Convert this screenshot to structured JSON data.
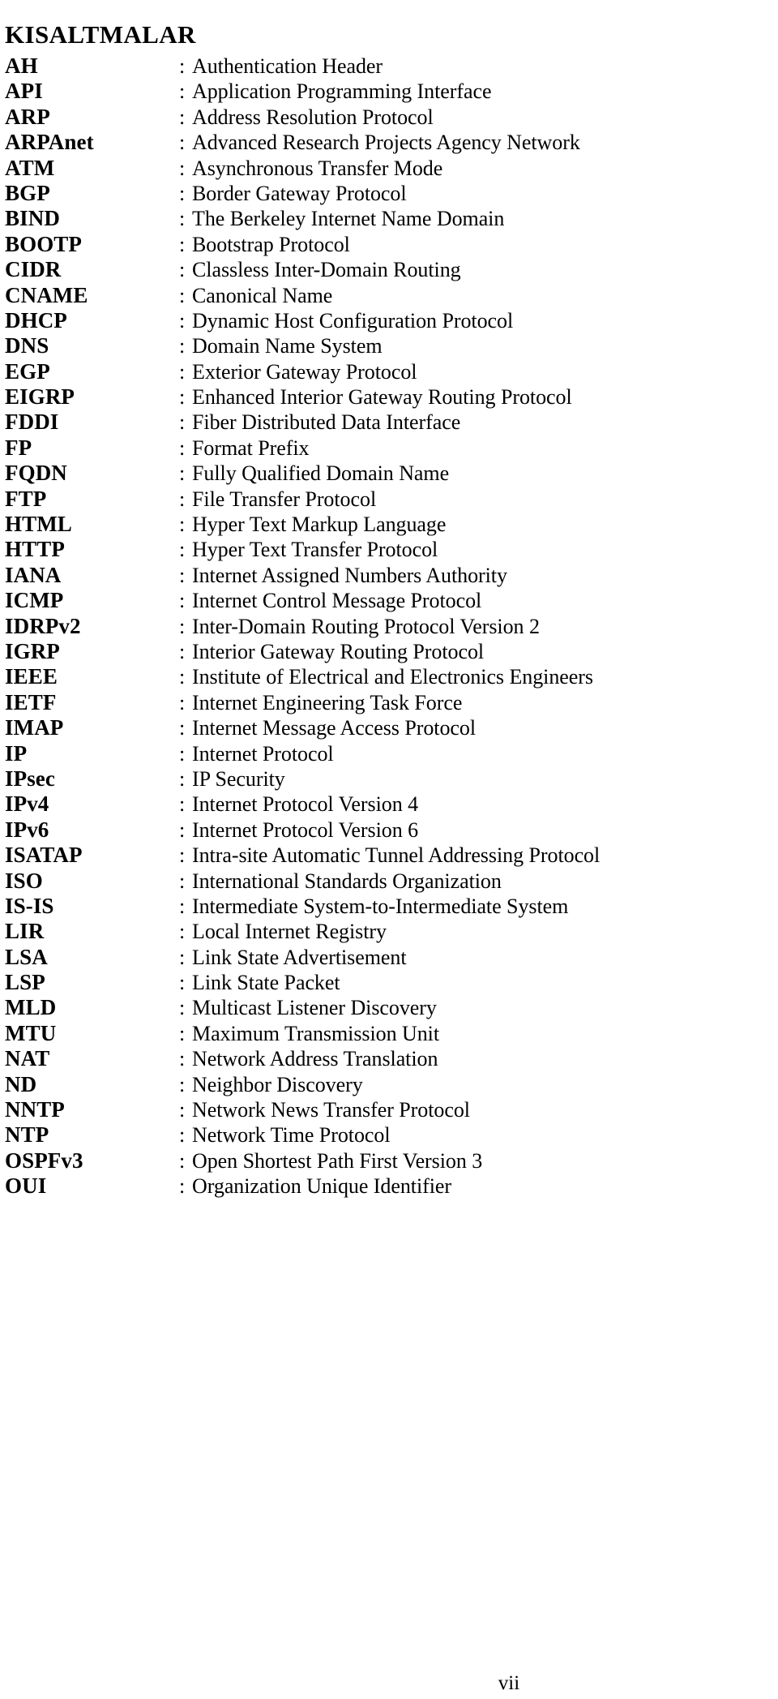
{
  "document": {
    "title": "KISALTMALAR",
    "separator": ":",
    "page_number": "vii"
  },
  "abbreviations": [
    {
      "term": "AH",
      "definition": "Authentication Header"
    },
    {
      "term": "API",
      "definition": "Application Programming Interface"
    },
    {
      "term": "ARP",
      "definition": "Address Resolution Protocol"
    },
    {
      "term": "ARPAnet",
      "definition": "Advanced Research Projects Agency Network"
    },
    {
      "term": "ATM",
      "definition": "Asynchronous Transfer Mode"
    },
    {
      "term": "BGP",
      "definition": "Border Gateway Protocol"
    },
    {
      "term": "BIND",
      "definition": "The Berkeley Internet Name Domain"
    },
    {
      "term": "BOOTP",
      "definition": "Bootstrap Protocol"
    },
    {
      "term": "CIDR",
      "definition": "Classless Inter-Domain Routing"
    },
    {
      "term": "CNAME",
      "definition": "Canonical Name"
    },
    {
      "term": "DHCP",
      "definition": "Dynamic Host Configuration Protocol"
    },
    {
      "term": "DNS",
      "definition": "Domain Name System"
    },
    {
      "term": "EGP",
      "definition": "Exterior Gateway Protocol"
    },
    {
      "term": "EIGRP",
      "definition": "Enhanced Interior Gateway Routing Protocol"
    },
    {
      "term": "FDDI",
      "definition": "Fiber Distributed Data Interface"
    },
    {
      "term": "FP",
      "definition": "Format Prefix"
    },
    {
      "term": "FQDN",
      "definition": "Fully Qualified Domain Name"
    },
    {
      "term": "FTP",
      "definition": "File Transfer Protocol"
    },
    {
      "term": "HTML",
      "definition": "Hyper Text Markup Language"
    },
    {
      "term": "HTTP",
      "definition": "Hyper Text Transfer Protocol"
    },
    {
      "term": "IANA",
      "definition": "Internet Assigned Numbers Authority"
    },
    {
      "term": "ICMP",
      "definition": "Internet Control Message Protocol"
    },
    {
      "term": "IDRPv2",
      "definition": "Inter-Domain Routing Protocol Version 2"
    },
    {
      "term": "IGRP",
      "definition": "Interior Gateway Routing Protocol"
    },
    {
      "term": "IEEE",
      "definition": "Institute of Electrical and Electronics Engineers"
    },
    {
      "term": "IETF",
      "definition": "Internet Engineering Task Force"
    },
    {
      "term": "IMAP",
      "definition": "Internet Message Access Protocol"
    },
    {
      "term": "IP",
      "definition": "Internet Protocol"
    },
    {
      "term": "IPsec",
      "definition": "IP Security"
    },
    {
      "term": "IPv4",
      "definition": "Internet Protocol Version 4"
    },
    {
      "term": "IPv6",
      "definition": "Internet Protocol Version 6"
    },
    {
      "term": "ISATAP",
      "definition": "Intra-site Automatic Tunnel Addressing Protocol"
    },
    {
      "term": "ISO",
      "definition": "International Standards Organization"
    },
    {
      "term": "IS-IS",
      "definition": "Intermediate System-to-Intermediate System"
    },
    {
      "term": "LIR",
      "definition": "Local Internet Registry"
    },
    {
      "term": "LSA",
      "definition": "Link State Advertisement"
    },
    {
      "term": "LSP",
      "definition": "Link State Packet"
    },
    {
      "term": "MLD",
      "definition": "Multicast Listener Discovery"
    },
    {
      "term": "MTU",
      "definition": "Maximum Transmission Unit"
    },
    {
      "term": "NAT",
      "definition": "Network Address Translation"
    },
    {
      "term": "ND",
      "definition": "Neighbor Discovery"
    },
    {
      "term": "NNTP",
      "definition": "Network News Transfer Protocol"
    },
    {
      "term": "NTP",
      "definition": "Network Time Protocol"
    },
    {
      "term": "OSPFv3",
      "definition": "Open Shortest Path First Version 3"
    },
    {
      "term": "OUI",
      "definition": "Organization Unique Identifier"
    }
  ]
}
